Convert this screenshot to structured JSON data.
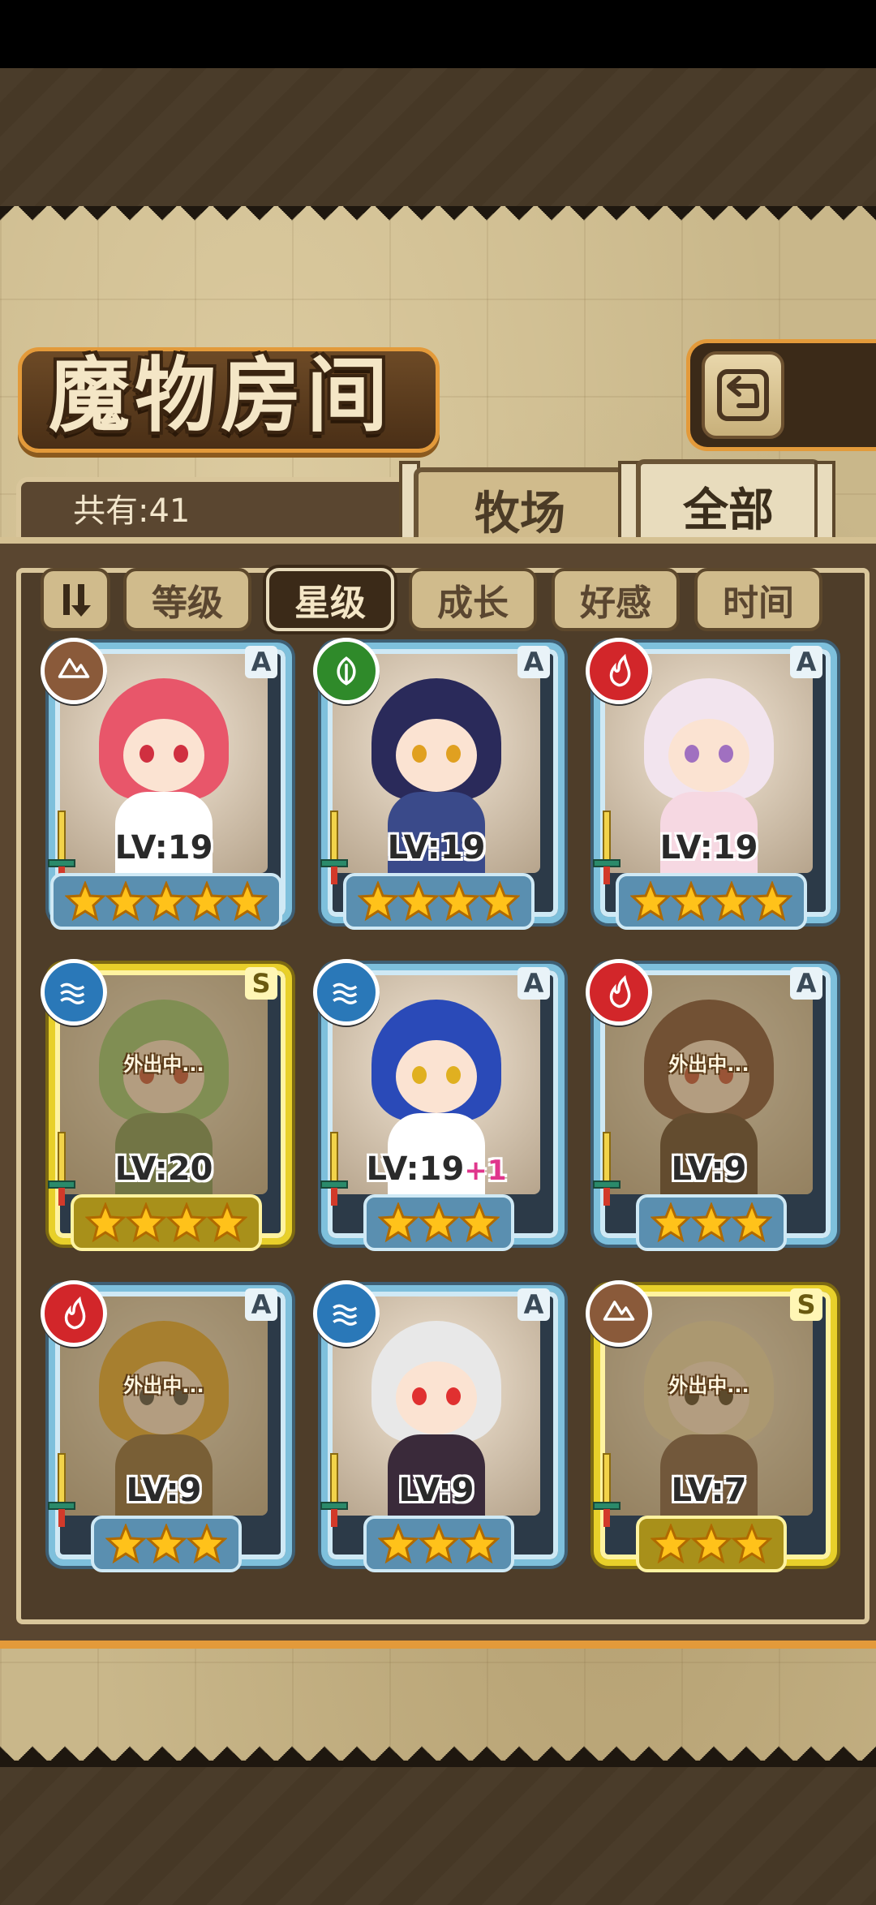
{
  "title": "魔物房间",
  "count_label": "共有:41",
  "tabs": [
    {
      "label": "牧场",
      "active": false
    },
    {
      "label": "全部",
      "active": true
    }
  ],
  "sort_buttons": [
    {
      "label": "等级",
      "active": false
    },
    {
      "label": "星级",
      "active": true
    },
    {
      "label": "成长",
      "active": false
    },
    {
      "label": "好感",
      "active": false
    },
    {
      "label": "时间",
      "active": false
    }
  ],
  "colors": {
    "element_earth": "#8a5a3a",
    "element_grass": "#2f8a2a",
    "element_fire": "#d2262a",
    "element_water": "#2a78b8"
  },
  "cards": [
    {
      "rank": "A",
      "element": "earth-icon",
      "level": "LV:19",
      "level_plus": "",
      "stars": 5,
      "away": "",
      "hair": "#e8566a",
      "body": "#ffffff",
      "eye": "#d03040"
    },
    {
      "rank": "A",
      "element": "leaf-icon",
      "level": "LV:19",
      "level_plus": "",
      "stars": 4,
      "away": "",
      "hair": "#2a2a5a",
      "body": "#3a4a8a",
      "eye": "#e0a020"
    },
    {
      "rank": "A",
      "element": "fire-icon",
      "level": "LV:19",
      "level_plus": "",
      "stars": 4,
      "away": "",
      "hair": "#f2e4ee",
      "body": "#f6d8e2",
      "eye": "#a070c0"
    },
    {
      "rank": "S",
      "element": "water-icon",
      "level": "LV:20",
      "level_plus": "",
      "stars": 4,
      "away": "外出中...",
      "hair": "#8ac070",
      "body": "#6a8a50",
      "eye": "#c04030"
    },
    {
      "rank": "A",
      "element": "water-icon",
      "level": "LV:19",
      "level_plus": "+1",
      "stars": 3,
      "away": "",
      "hair": "#2a4ab8",
      "body": "#ffffff",
      "eye": "#e0b020"
    },
    {
      "rank": "A",
      "element": "fire-icon",
      "level": "LV:9",
      "level_plus": "",
      "stars": 3,
      "away": "外出中...",
      "hair": "#6a3a2a",
      "body": "#4a3020",
      "eye": "#c04030"
    },
    {
      "rank": "A",
      "element": "fire-icon",
      "level": "LV:9",
      "level_plus": "",
      "stars": 3,
      "away": "外出中...",
      "hair": "#e0a020",
      "body": "#7a5a30",
      "eye": "#3a3a3a"
    },
    {
      "rank": "A",
      "element": "water-icon",
      "level": "LV:9",
      "level_plus": "",
      "stars": 3,
      "away": "",
      "hair": "#e8e8e8",
      "body": "#3a2a3a",
      "eye": "#e03030"
    },
    {
      "rank": "S",
      "element": "earth-icon",
      "level": "LV:7",
      "level_plus": "",
      "stars": 3,
      "away": "外出中...",
      "hair": "#e8d8b0",
      "body": "#6a4a3a",
      "eye": "#3a2a1a"
    }
  ]
}
